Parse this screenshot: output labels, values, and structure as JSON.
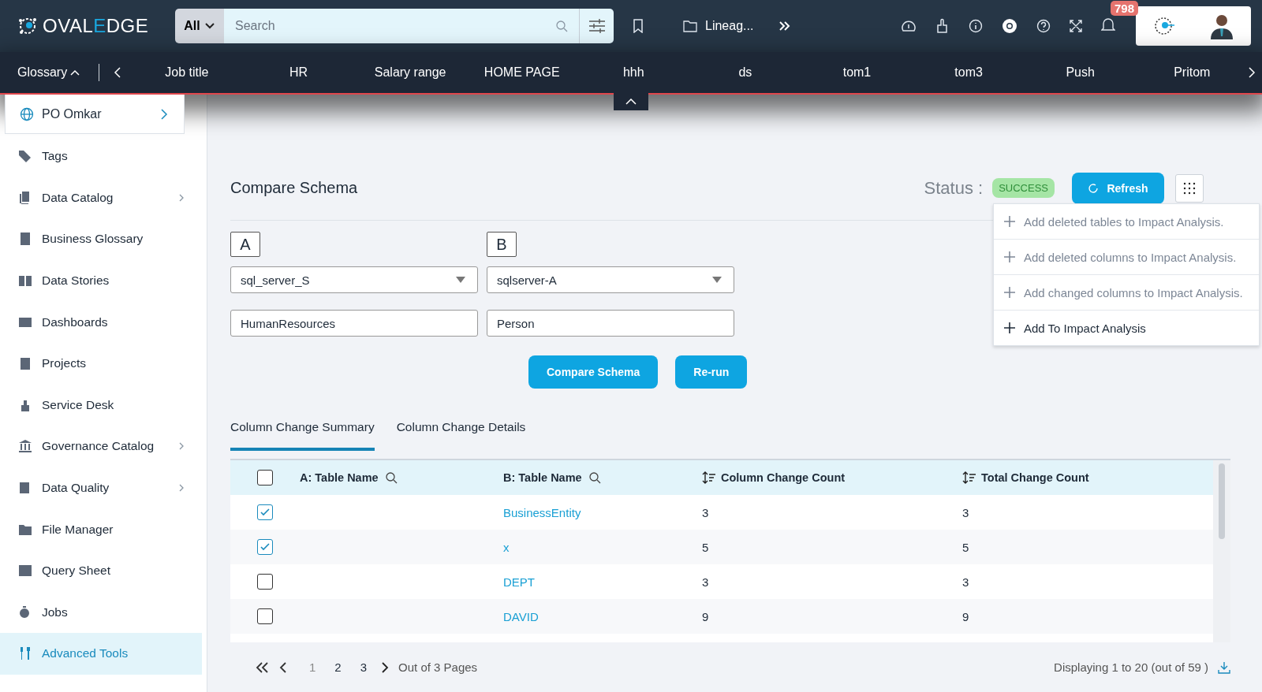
{
  "header": {
    "logo": [
      "OVAL",
      "E",
      "DGE"
    ],
    "search": {
      "scope": "All",
      "placeholder": "Search"
    },
    "breadcrumb": "Lineag...",
    "notifications": "798"
  },
  "nav": {
    "menu": "Glossary",
    "tabs": [
      "Job title",
      "HR",
      "Salary range",
      "HOME PAGE",
      "hhh",
      "ds",
      "tom1",
      "tom3",
      "Push",
      "Pritom"
    ]
  },
  "sidebar": {
    "domain": "PO Omkar",
    "items": [
      {
        "label": "Tags",
        "expandable": false,
        "selected": false
      },
      {
        "label": "Data Catalog",
        "expandable": true,
        "selected": false
      },
      {
        "label": "Business Glossary",
        "expandable": false,
        "selected": false
      },
      {
        "label": "Data Stories",
        "expandable": false,
        "selected": false
      },
      {
        "label": "Dashboards",
        "expandable": false,
        "selected": false
      },
      {
        "label": "Projects",
        "expandable": false,
        "selected": false
      },
      {
        "label": "Service Desk",
        "expandable": false,
        "selected": false
      },
      {
        "label": "Governance Catalog",
        "expandable": true,
        "selected": false
      },
      {
        "label": "Data Quality",
        "expandable": true,
        "selected": false
      },
      {
        "label": "File Manager",
        "expandable": false,
        "selected": false
      },
      {
        "label": "Query Sheet",
        "expandable": false,
        "selected": false
      },
      {
        "label": "Jobs",
        "expandable": false,
        "selected": false
      },
      {
        "label": "Advanced Tools",
        "expandable": false,
        "selected": true
      }
    ]
  },
  "page": {
    "title": "Compare Schema",
    "status_label": "Status :",
    "status": "SUCCESS",
    "refresh": "Refresh",
    "menu": [
      {
        "label": "Add deleted tables to Impact Analysis.",
        "disabled": true
      },
      {
        "label": "Add deleted columns to Impact Analysis.",
        "disabled": true
      },
      {
        "label": "Add changed columns to Impact Analysis.",
        "disabled": true
      },
      {
        "label": "Add To Impact Analysis",
        "disabled": false
      }
    ],
    "sides": [
      {
        "label": "A",
        "connector": "sql_server_S",
        "schema": "HumanResources"
      },
      {
        "label": "B",
        "connector": "sqlserver-A",
        "schema": "Person"
      }
    ],
    "buttons": [
      "Compare Schema",
      "Re-run"
    ],
    "tabs": [
      {
        "label": "Column Change Summary",
        "selected": true
      },
      {
        "label": "Column Change Details",
        "selected": false
      }
    ],
    "table": {
      "select_all": false,
      "columns": [
        "A: Table Name",
        "B: Table Name",
        "Column Change Count",
        "Total Change Count"
      ],
      "rows": [
        {
          "checked": true,
          "b": "BusinessEntity",
          "column_changes": "3",
          "total_changes": "3"
        },
        {
          "checked": true,
          "b": "x",
          "column_changes": "5",
          "total_changes": "5"
        },
        {
          "checked": false,
          "b": "DEPT",
          "column_changes": "3",
          "total_changes": "3"
        },
        {
          "checked": false,
          "b": "DAVID",
          "column_changes": "9",
          "total_changes": "9"
        }
      ]
    },
    "pagination": {
      "pages": [
        {
          "label": "1",
          "selected": true
        },
        {
          "label": "2",
          "selected": false
        },
        {
          "label": "3",
          "selected": false
        }
      ],
      "summary": "Out of 3 Pages",
      "displaying": "Displaying 1 to 20  (out of 59 )"
    }
  }
}
